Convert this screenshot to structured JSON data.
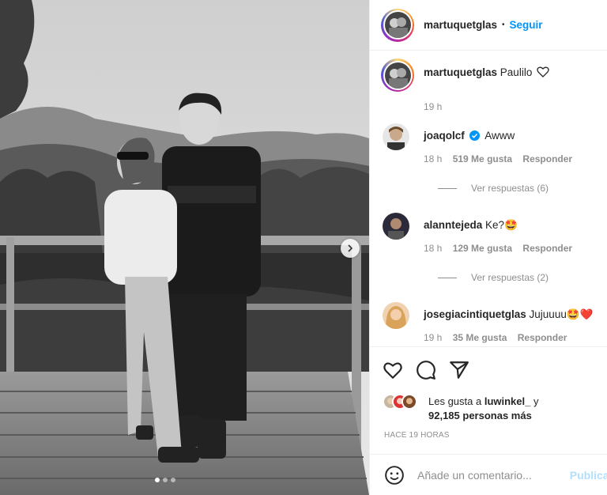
{
  "post": {
    "username": "martuquetglas",
    "separator": "•",
    "follow_label": "Seguir",
    "carousel_dots": 3,
    "active_dot": 1
  },
  "caption": {
    "username": "martuquetglas",
    "text": "Paulilo",
    "time": "19 h"
  },
  "comments": [
    {
      "username": "joaqolcf",
      "verified": true,
      "text": "Awww",
      "time": "18 h",
      "likes": "519 Me gusta",
      "reply_label": "Responder",
      "replies_label": "Ver respuestas (6)"
    },
    {
      "username": "alanntejeda",
      "verified": false,
      "text": "Ke?🤩",
      "time": "18 h",
      "likes": "129 Me gusta",
      "reply_label": "Responder",
      "replies_label": "Ver respuestas (2)"
    },
    {
      "username": "josegiacintiquetglas",
      "verified": false,
      "text": "Jujuuuu🤩❤️",
      "time": "19 h",
      "likes": "35 Me gusta",
      "reply_label": "Responder"
    }
  ],
  "likes": {
    "line1_prefix": "Les gusta a",
    "liker_name": "luwinkel_",
    "line1_suffix": "y",
    "line2": "92,185 personas más"
  },
  "time_ago": "HACE 19 HORAS",
  "add_comment": {
    "placeholder": "Añade un comentario...",
    "publish_label": "Publicar"
  },
  "colors": {
    "accent": "#0095f6",
    "muted": "#8e8e8e",
    "text": "#262626",
    "border": "#efefef"
  }
}
